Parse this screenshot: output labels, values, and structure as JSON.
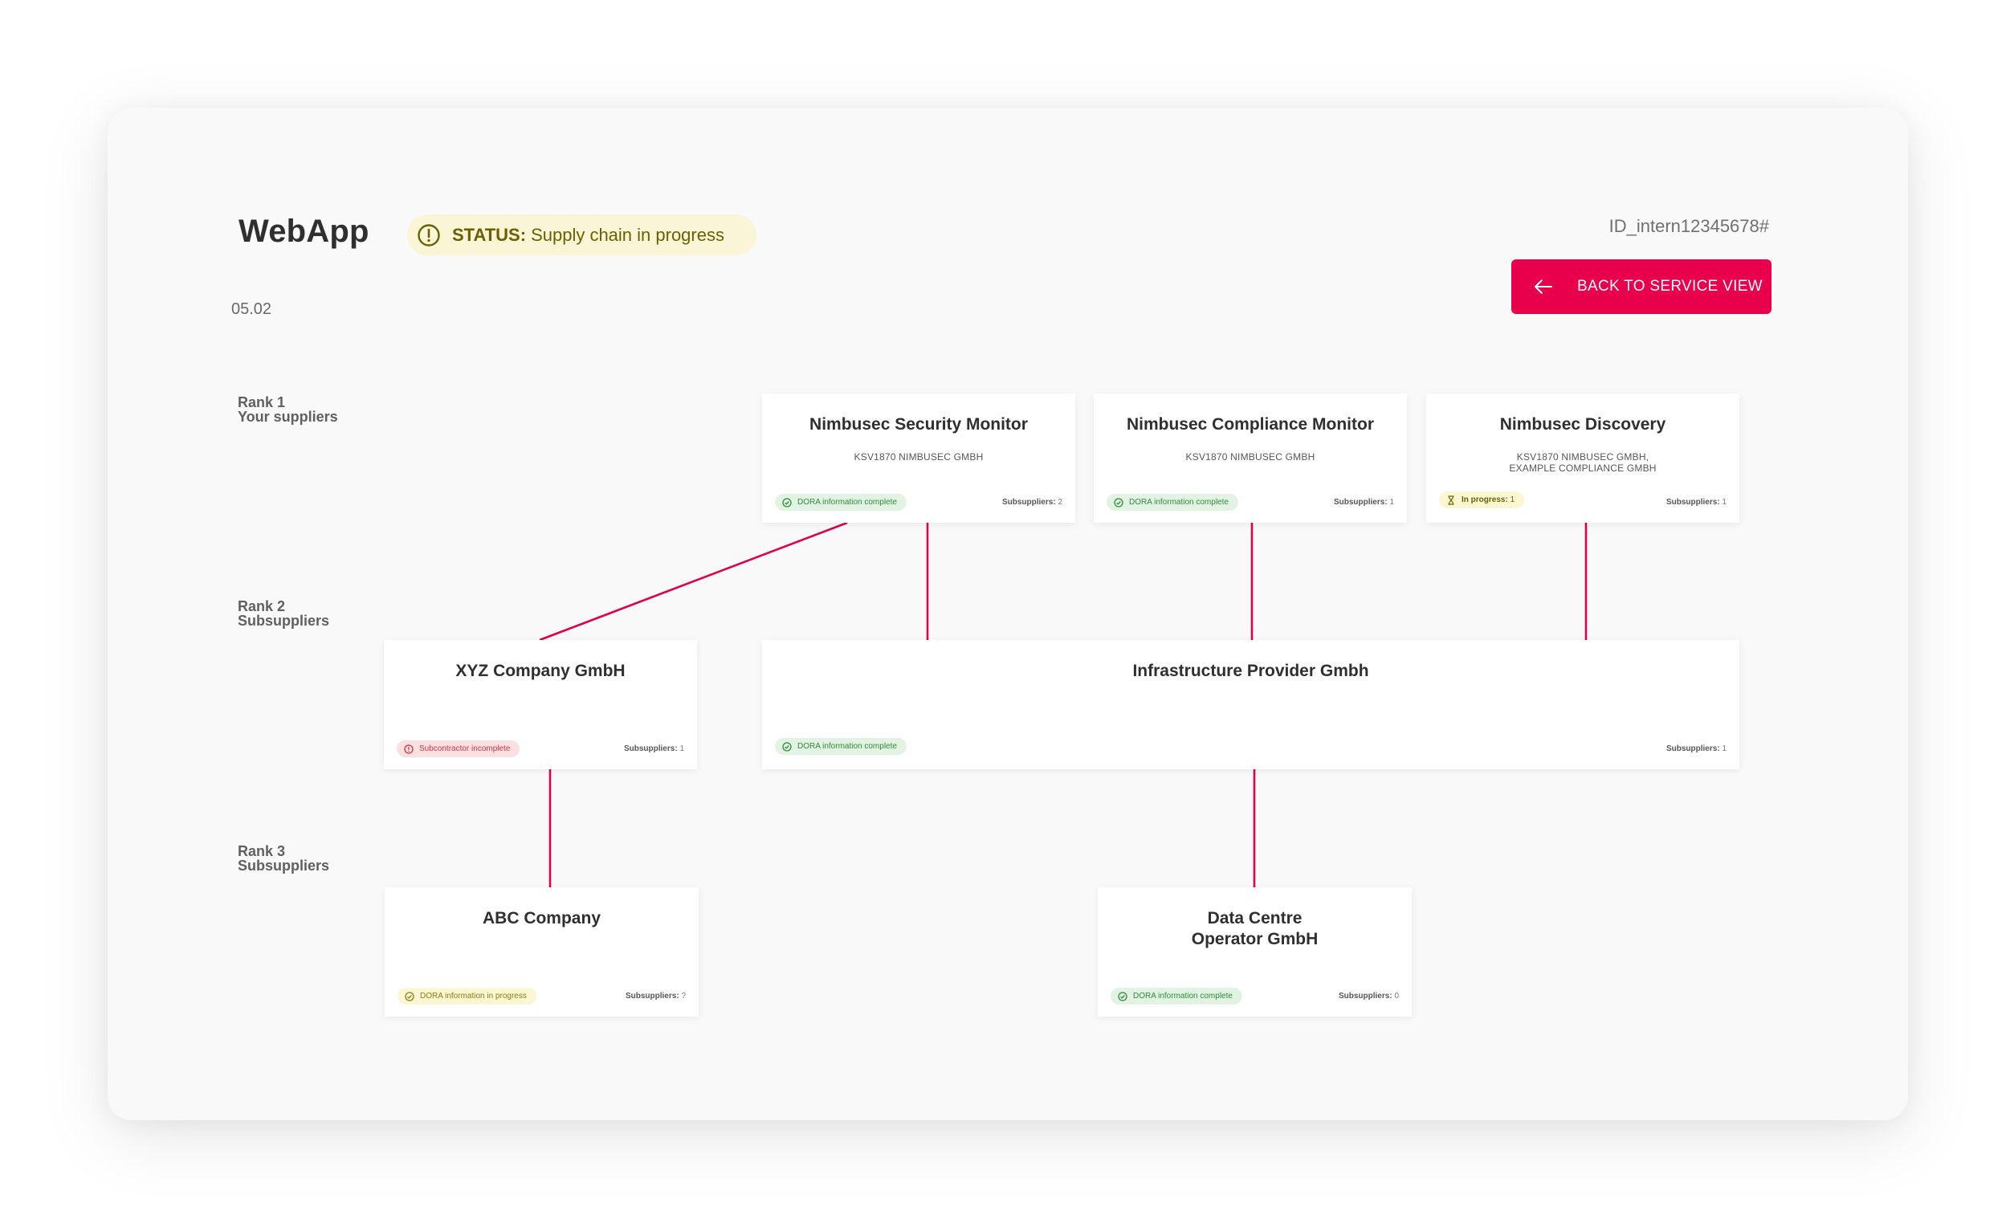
{
  "header": {
    "title": "WebApp",
    "status_label": "STATUS:",
    "status_text": "Supply chain in progress",
    "status_icon": "alert-circle-icon",
    "date": "05.02",
    "internal_id": "ID_intern12345678#",
    "back_button_label": "BACK TO SERVICE VIEW",
    "back_button_icon": "arrow-left-icon"
  },
  "colors": {
    "accent": "#e8004d",
    "connector": "#e0004d",
    "status_bg": "#faf5d6",
    "status_text": "#6b6000",
    "complete_bg": "#e3f3e3",
    "complete_text": "#2e8a3a",
    "incomplete_bg": "#fbe0e2",
    "incomplete_text": "#d0343f",
    "progress_bg": "#fbf7d3",
    "progress_text": "#8a7a10"
  },
  "ranks": [
    {
      "title": "Rank 1",
      "subtitle": "Your suppliers"
    },
    {
      "title": "Rank 2",
      "subtitle": "Subsuppliers"
    },
    {
      "title": "Rank 3",
      "subtitle": "Subsuppliers"
    }
  ],
  "subsuppliers_label": "Subsuppliers:",
  "cards": {
    "security_monitor": {
      "name": "Nimbusec Security Monitor",
      "company": "KSV1870 NIMBUSEC GMBH",
      "badge": "DORA information complete",
      "badge_icon": "check-circle-icon",
      "subsuppliers": "2"
    },
    "compliance_monitor": {
      "name": "Nimbusec Compliance Monitor",
      "company": "KSV1870 NIMBUSEC GMBH",
      "badge": "DORA information complete",
      "badge_icon": "check-circle-icon",
      "subsuppliers": "1"
    },
    "discovery": {
      "name": "Nimbusec Discovery",
      "company_line1": "KSV1870 NIMBUSEC GMBH,",
      "company_line2": "EXAMPLE COMPLIANCE GMBH",
      "badge_label": "In progress:",
      "badge_value": "1",
      "badge_icon": "hourglass-icon",
      "subsuppliers": "1"
    },
    "xyz": {
      "name": "XYZ Company GmbH",
      "badge": "Subcontractor incomplete",
      "badge_icon": "alert-circle-icon",
      "subsuppliers": "1"
    },
    "infrastructure": {
      "name": "Infrastructure Provider Gmbh",
      "badge": "DORA information complete",
      "badge_icon": "check-circle-icon",
      "subsuppliers": "1"
    },
    "abc": {
      "name": "ABC Company",
      "badge": "DORA information in progress",
      "badge_icon": "check-circle-icon",
      "subsuppliers": "?"
    },
    "data_centre": {
      "name_line1": "Data Centre",
      "name_line2": "Operator GmbH",
      "badge": "DORA information complete",
      "badge_icon": "check-circle-icon",
      "subsuppliers": "0"
    }
  },
  "connections": [
    {
      "from": "security_monitor",
      "to": "xyz"
    },
    {
      "from": "security_monitor",
      "to": "infrastructure"
    },
    {
      "from": "compliance_monitor",
      "to": "infrastructure"
    },
    {
      "from": "discovery",
      "to": "infrastructure"
    },
    {
      "from": "xyz",
      "to": "abc"
    },
    {
      "from": "infrastructure",
      "to": "data_centre"
    }
  ]
}
